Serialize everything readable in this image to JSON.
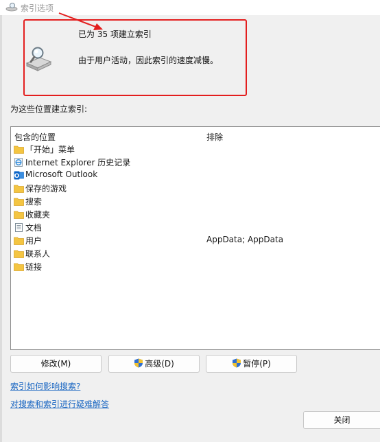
{
  "window": {
    "title": "索引选项"
  },
  "status": {
    "count_text": "已为 35 项建立索引",
    "message": "由于用户活动，因此索引的速度减慢。"
  },
  "locations": {
    "label": "为这些位置建立索引:",
    "columns": {
      "included": "包含的位置",
      "exclude": "排除"
    },
    "rows": [
      {
        "name": "「开始」菜单",
        "exclude": "",
        "icon": "folder-icon"
      },
      {
        "name": "Internet Explorer 历史记录",
        "exclude": "",
        "icon": "ie-history-icon"
      },
      {
        "name": "Microsoft Outlook",
        "exclude": "",
        "icon": "outlook-icon"
      },
      {
        "name": "保存的游戏",
        "exclude": "",
        "icon": "folder-icon"
      },
      {
        "name": "搜索",
        "exclude": "",
        "icon": "folder-icon"
      },
      {
        "name": "收藏夹",
        "exclude": "",
        "icon": "folder-icon"
      },
      {
        "name": "文档",
        "exclude": "",
        "icon": "document-icon"
      },
      {
        "name": "用户",
        "exclude": "AppData; AppData",
        "icon": "folder-icon"
      },
      {
        "name": "联系人",
        "exclude": "",
        "icon": "folder-icon"
      },
      {
        "name": "链接",
        "exclude": "",
        "icon": "folder-icon"
      }
    ]
  },
  "buttons": {
    "modify": "修改(M)",
    "advanced": "高级(D)",
    "pause": "暂停(P)",
    "close": "关闭"
  },
  "links": {
    "how_indexing_affects": "索引如何影响搜索?",
    "troubleshoot": "对搜索和索引进行疑难解答"
  },
  "colors": {
    "highlight": "#e31e1e",
    "link": "#1a66c2",
    "folder": "#f4c542",
    "outlook": "#0a64c8",
    "shield_blue": "#2f6fd0",
    "shield_yellow": "#f2c230"
  }
}
